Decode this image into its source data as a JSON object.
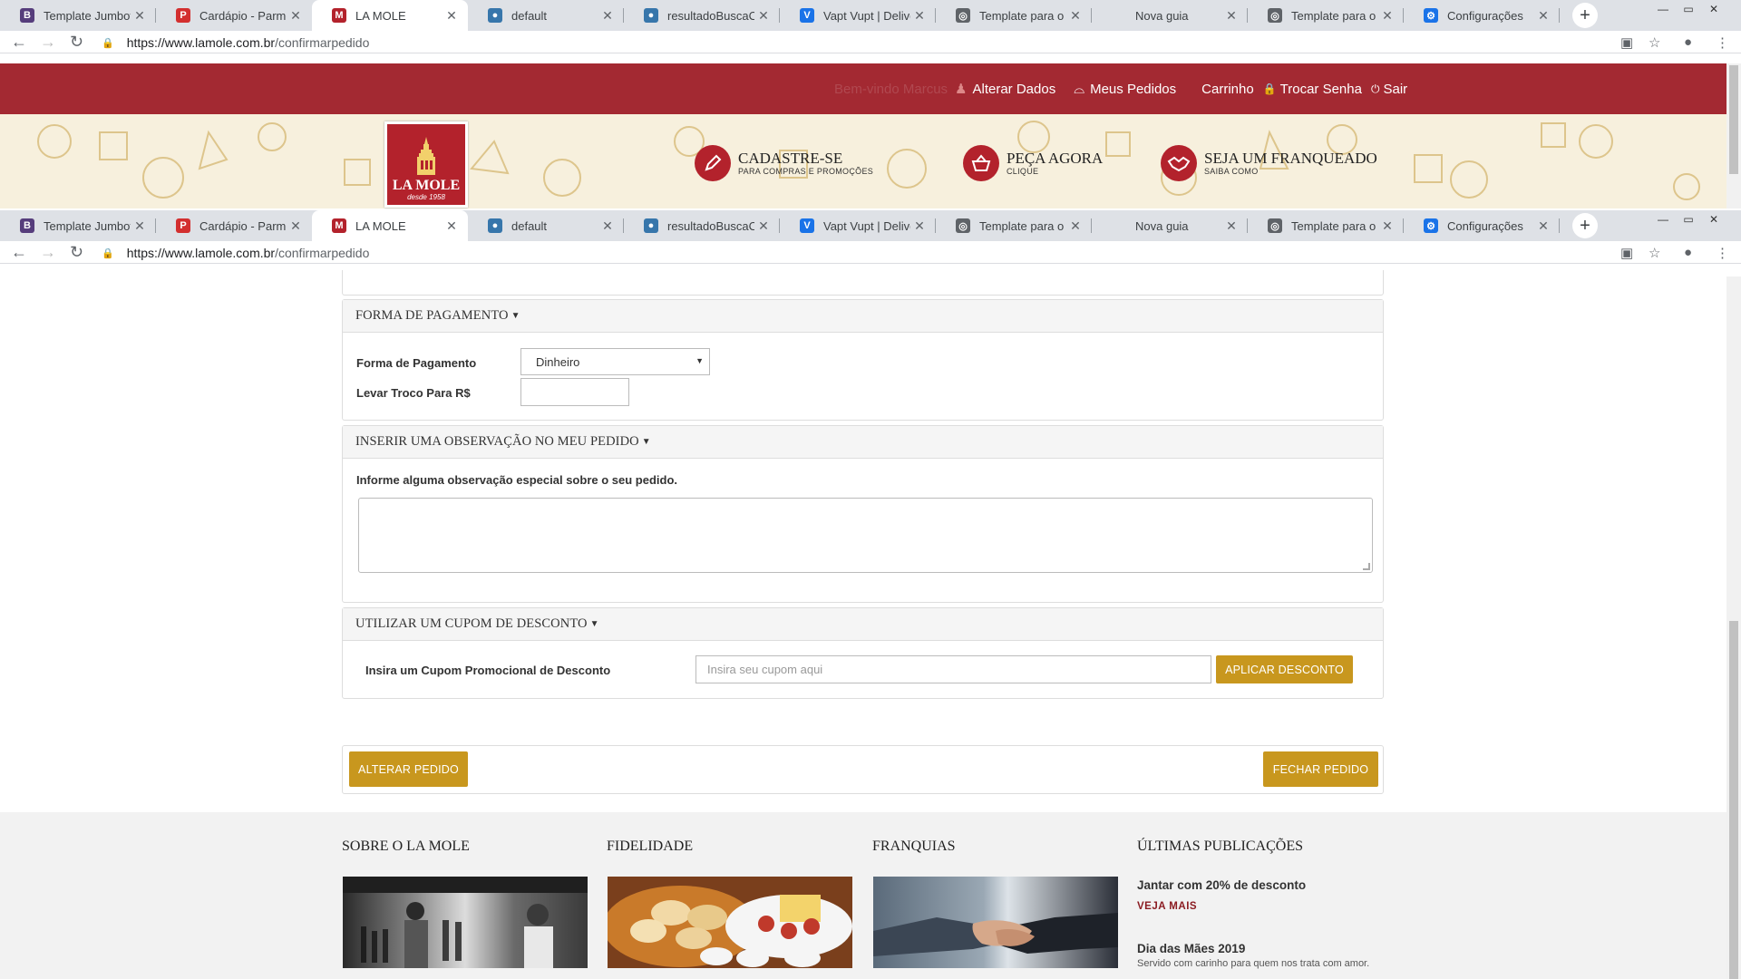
{
  "browser": {
    "tabs": [
      {
        "title": "Template Jumbotron",
        "favicon": "B",
        "favicon_color": "#563d7c"
      },
      {
        "title": "Cardápio - Parmê",
        "favicon": "P",
        "favicon_color": "#d32f2f"
      },
      {
        "title": "LA MOLE",
        "favicon": "M",
        "favicon_color": "#b3222c"
      },
      {
        "title": "default",
        "favicon": "●",
        "favicon_color": "#3776ab"
      },
      {
        "title": "resultadoBuscaCepE",
        "favicon": "●",
        "favicon_color": "#3776ab"
      },
      {
        "title": "Vapt Vupt | Delivery",
        "favicon": "V",
        "favicon_color": "#1a73e8"
      },
      {
        "title": "Template para o car",
        "favicon": "◎",
        "favicon_color": "#5f6368"
      },
      {
        "title": "Nova guia",
        "favicon": "",
        "favicon_color": "transparent"
      },
      {
        "title": "Template para o car",
        "favicon": "◎",
        "favicon_color": "#5f6368"
      },
      {
        "title": "Configurações",
        "favicon": "⚙",
        "favicon_color": "#1a73e8"
      }
    ],
    "active_tab": 2,
    "url_host": "https://www.lamole.com.br",
    "url_path": "/confirmarpedido"
  },
  "header": {
    "welcome": "Bem-vindo Marcus",
    "alter_data": "Alterar Dados",
    "my_orders": "Meus Pedidos",
    "cart": "Carrinho",
    "change_password": "Trocar Senha",
    "logout": "Sair"
  },
  "logo": {
    "brand": "LA MOLE",
    "since": "desde 1958"
  },
  "cta": [
    {
      "title": "CADASTRE-SE",
      "subtitle": "PARA COMPRAS E PROMOÇÕES",
      "icon": "pencil-icon"
    },
    {
      "title": "PEÇA AGORA",
      "subtitle": "CLIQUE",
      "icon": "basket-icon"
    },
    {
      "title": "SEJA UM FRANQUEADO",
      "subtitle": "SAIBA COMO",
      "icon": "handshake-icon"
    }
  ],
  "payment": {
    "heading": "FORMA DE PAGAMENTO",
    "method_label": "Forma de Pagamento",
    "method_value": "Dinheiro",
    "change_label": "Levar Troco Para R$",
    "change_value": ""
  },
  "observation": {
    "heading": "INSERIR UMA OBSERVAÇÃO NO MEU PEDIDO",
    "label": "Informe alguma observação especial sobre o seu pedido.",
    "value": ""
  },
  "coupon": {
    "heading": "UTILIZAR UM CUPOM DE DESCONTO",
    "label": "Insira um Cupom Promocional de Desconto",
    "placeholder": "Insira seu cupom aqui",
    "apply_button": "APLICAR DESCONTO"
  },
  "actions": {
    "change_order": "ALTERAR PEDIDO",
    "close_order": "FECHAR PEDIDO"
  },
  "footer": {
    "about": "SOBRE O LA MOLE",
    "loyalty": "FIDELIDADE",
    "franchises": "FRANQUIAS",
    "latest": "ÚLTIMAS PUBLICAÇÕES",
    "posts": [
      {
        "title": "Jantar com 20% de desconto",
        "link": "VEJA MAIS"
      },
      {
        "title": "Dia das Mães 2019",
        "text": "Servido com carinho para quem nos trata com amor."
      }
    ]
  },
  "colors": {
    "brand_red": "#a32932",
    "button_gold": "#c8971e"
  }
}
